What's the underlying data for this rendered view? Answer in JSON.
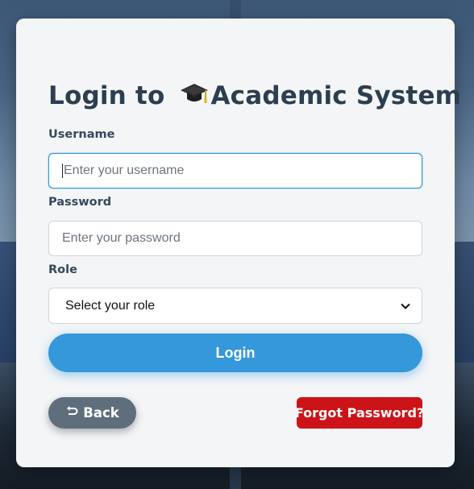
{
  "form": {
    "title_prefix": "Login to ",
    "title_suffix": "Academic System",
    "title_icon": "graduation-cap-icon",
    "username_label": "Username",
    "username_placeholder": "Enter your username",
    "password_label": "Password",
    "password_placeholder": "Enter your password",
    "role_label": "Role",
    "role_selected": "Select your role",
    "login_label": "Login",
    "back_label": "Back",
    "back_icon": "return-arrow-icon",
    "forgot_label": "Forgot Password?"
  },
  "colors": {
    "primary": "#3498db",
    "back": "#5e6e7c",
    "danger": "#cc1418",
    "title": "#2c3e50"
  }
}
